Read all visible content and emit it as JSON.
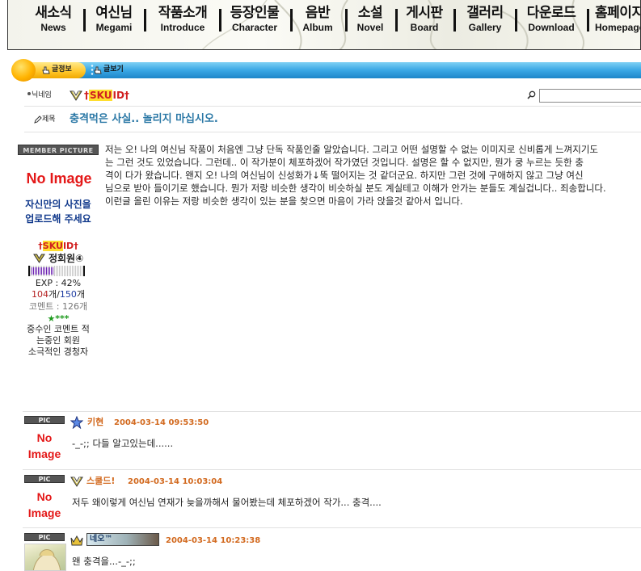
{
  "nav": [
    {
      "ko": "새소식",
      "en": "News"
    },
    {
      "ko": "여신님",
      "en": "Megami"
    },
    {
      "ko": "작품소개",
      "en": "Introduce"
    },
    {
      "ko": "등장인물",
      "en": "Character"
    },
    {
      "ko": "음반",
      "en": "Album"
    },
    {
      "ko": "소설",
      "en": "Novel"
    },
    {
      "ko": "게시판",
      "en": "Board"
    },
    {
      "ko": "갤러리",
      "en": "Gallery"
    },
    {
      "ko": "다운로드",
      "en": "Download"
    },
    {
      "ko": "홈페이지",
      "en": "Homepage"
    }
  ],
  "tabs": {
    "t1": "글정보",
    "t2": "글보기"
  },
  "labels": {
    "nickname": "닉네임",
    "subject": "제목",
    "member_picture": "MEMBER PICTURE",
    "pic": "PIC"
  },
  "post": {
    "author_prefix": "†",
    "author_highlight": "SKU",
    "author_suffix": "ID†",
    "title": "충격먹은 사실.. 놀리지 마십시오.",
    "body": [
      "저는 오! 나의 여신님 작품이 처음엔 그냥 단독 작품인줄 알았습니다. 그리고 어떤 설명할 수 없는 이미지로 신비롭게 느껴지기도",
      "는 그런 것도 있었습니다. 그런데.. 이 작가분이 체포하겠어 작가였던 것입니다. 설명은 할 수 없지만, 뭔가 쿵 누르는 듯한 충",
      "격이 다가 왔습니다. 왠지 오! 나의 여신님이 신성화가↓뚝 떨어지는 것 같더군요. 하지만 그런 것에 구애하지 않고 그냥 여신",
      "님으로 받아 들이기로 했습니다. 뭔가 저랑 비슷한 생각이 비슷하실 분도 계실테고 이해가 안가는 분들도 계실겁니다.. 죄송합니다.",
      "이런글 올린 이유는 저랑 비슷한 생각이 있는 분을 찾으면 마음이 가라 앉을것 같아서 입니다."
    ]
  },
  "member": {
    "no_image": "No Image",
    "upload_note_1": "자신만의 사진을",
    "upload_note_2": "업로드해 주세요",
    "nick_prefix": "†",
    "nick_highlight": "SKU",
    "nick_suffix": "ID†",
    "level": "정회원④",
    "exp_percent": 42,
    "exp_text": "EXP : 42%",
    "posts_count": "104",
    "posts_sep": "개/",
    "posts_max": "150",
    "posts_unit": "개",
    "comments": "코멘트 : 126개",
    "stars": "★***",
    "desc": [
      "중수인 코멘트 적",
      "는중인 회원",
      "소극적인 경청자"
    ]
  },
  "comments": [
    {
      "author": "키현",
      "date": "2004-03-14 09:53:50",
      "text": "-_-;; 다들 알고있는데......",
      "pic": "No Image"
    },
    {
      "author": "스쿨드!",
      "date": "2004-03-14 10:03:04",
      "text": "저두 왜이렇게 여신님 연재가 늦을까해서 물어봤는데 체포하겠어 작가... 충격....",
      "pic": "No Image"
    },
    {
      "author": "네오™",
      "date": "2004-03-14 10:23:38",
      "text": "왠 충격을...-_-;;",
      "pic": ""
    }
  ]
}
